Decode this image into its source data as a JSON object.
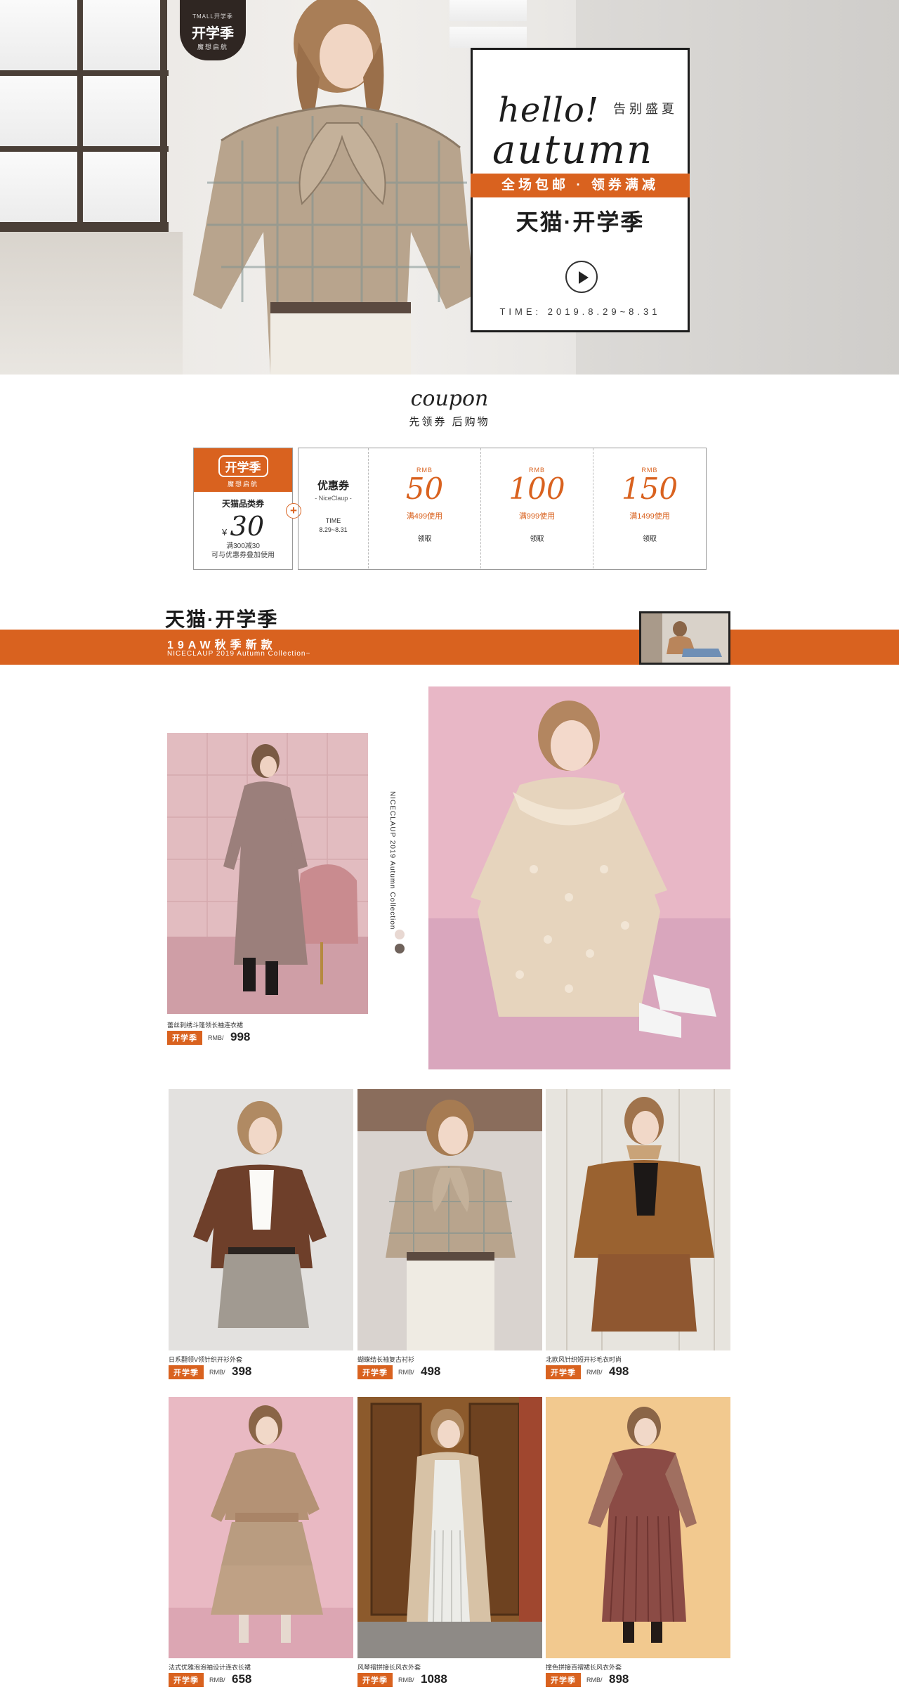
{
  "hero": {
    "tag_small": "TMALL开学季",
    "tag_big": "开学季",
    "tag_sub": "魔想启航",
    "hello": "hello!",
    "farewell": "告别盛夏",
    "autumn": "autumn",
    "band": "全场包邮 · 领券满减",
    "tmall": "天猫·开学季",
    "time": "TIME: 2019.8.29~8.31"
  },
  "coupon_section": {
    "script": "coupon",
    "subtitle": "先领券 后购物"
  },
  "tmall_coupon": {
    "badge": "开学季",
    "badge_sub": "魔想启航",
    "name": "天猫品类券",
    "currency": "¥",
    "amount": "30",
    "rule_1": "满300减30",
    "rule_2": "可与优惠券叠加使用"
  },
  "plus": "+",
  "shop_coupons": {
    "title": "优惠券",
    "brand": "- NiceClaup -",
    "time_label": "TIME",
    "time_range": "8.29~8.31",
    "items": [
      {
        "currency": "RMB",
        "value": "50",
        "condition": "满499使用",
        "action": "领取"
      },
      {
        "currency": "RMB",
        "value": "100",
        "condition": "满999使用",
        "action": "领取"
      },
      {
        "currency": "RMB",
        "value": "150",
        "condition": "满1499使用",
        "action": "领取"
      }
    ]
  },
  "section": {
    "title": "天猫·开学季",
    "band_title": "19AW秋季新款",
    "band_sub": "NICECLAUP 2019 Autumn Collection~",
    "vertical_text": "NICECLAUP 2019 Autumn Collection"
  },
  "products": [
    {
      "name": "蕾丝刺绣斗篷领长袖连衣裙",
      "tag": "开学季",
      "currency": "RMB/",
      "price": "998"
    },
    {
      "name": "日系翻领V领针织开衫外套",
      "tag": "开学季",
      "currency": "RMB/",
      "price": "398"
    },
    {
      "name": "蝴蝶结长袖复古衬衫",
      "tag": "开学季",
      "currency": "RMB/",
      "price": "498"
    },
    {
      "name": "北欧风针织短开衫毛衣时尚",
      "tag": "开学季",
      "currency": "RMB/",
      "price": "498"
    },
    {
      "name": "法式优雅泡泡袖设计连衣长裙",
      "tag": "开学季",
      "currency": "RMB/",
      "price": "658"
    },
    {
      "name": "风琴褶拼接长风衣外套",
      "tag": "开学季",
      "currency": "RMB/",
      "price": "1088"
    },
    {
      "name": "撞色拼接百褶裙长风衣外套",
      "tag": "开学季",
      "currency": "RMB/",
      "price": "898"
    }
  ],
  "colors": {
    "accent": "#d9621f",
    "dark": "#1d1d1d",
    "swatch_1": "#e8d8d2",
    "swatch_2": "#6f625b"
  }
}
